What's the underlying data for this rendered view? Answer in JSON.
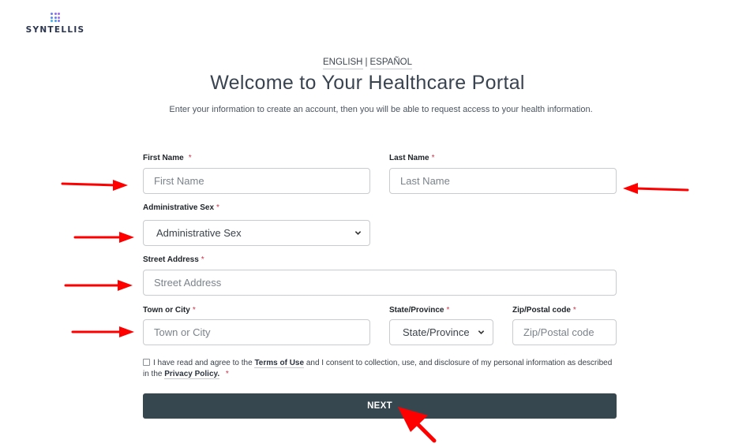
{
  "brand": {
    "name": "SYNTELLIS",
    "logo_dot_colors": [
      "#6a7cf0",
      "#8b6ff0",
      "#a06af0",
      "#5a8cf0",
      "#6c7df0",
      "#9a72f0",
      "#40b4f0",
      "#4aa0f0",
      "#7a78f0"
    ]
  },
  "language": {
    "english": "ENGLISH",
    "separator": "|",
    "spanish": "ESPAÑOL"
  },
  "header": {
    "title": "Welcome to Your Healthcare Portal",
    "subtitle": "Enter your information to create an account, then you will be able to request access to your health information."
  },
  "form": {
    "required_marker": "*",
    "first_name": {
      "label": "First Name",
      "placeholder": "First Name",
      "value": ""
    },
    "last_name": {
      "label": "Last Name",
      "placeholder": "Last Name",
      "value": ""
    },
    "admin_sex": {
      "label": "Administrative Sex",
      "selected": "Administrative Sex"
    },
    "street_address": {
      "label": "Street Address",
      "placeholder": "Street Address",
      "value": ""
    },
    "town_city": {
      "label": "Town or City",
      "placeholder": "Town or City",
      "value": ""
    },
    "state_province": {
      "label": "State/Province",
      "selected": "State/Province"
    },
    "zip_postal": {
      "label": "Zip/Postal code",
      "placeholder": "Zip/Postal code",
      "value": ""
    },
    "consent": {
      "checked": false,
      "text_1": "I have read and agree to the",
      "terms_link": "Terms of Use",
      "text_2": "and I consent to collection, use, and disclosure of my personal information as described in the",
      "privacy_link": "Privacy Policy."
    },
    "next_label": "NEXT"
  },
  "colors": {
    "button_bg": "#37474f",
    "required": "#d0344a",
    "annotation_arrow": "#ff0000"
  }
}
